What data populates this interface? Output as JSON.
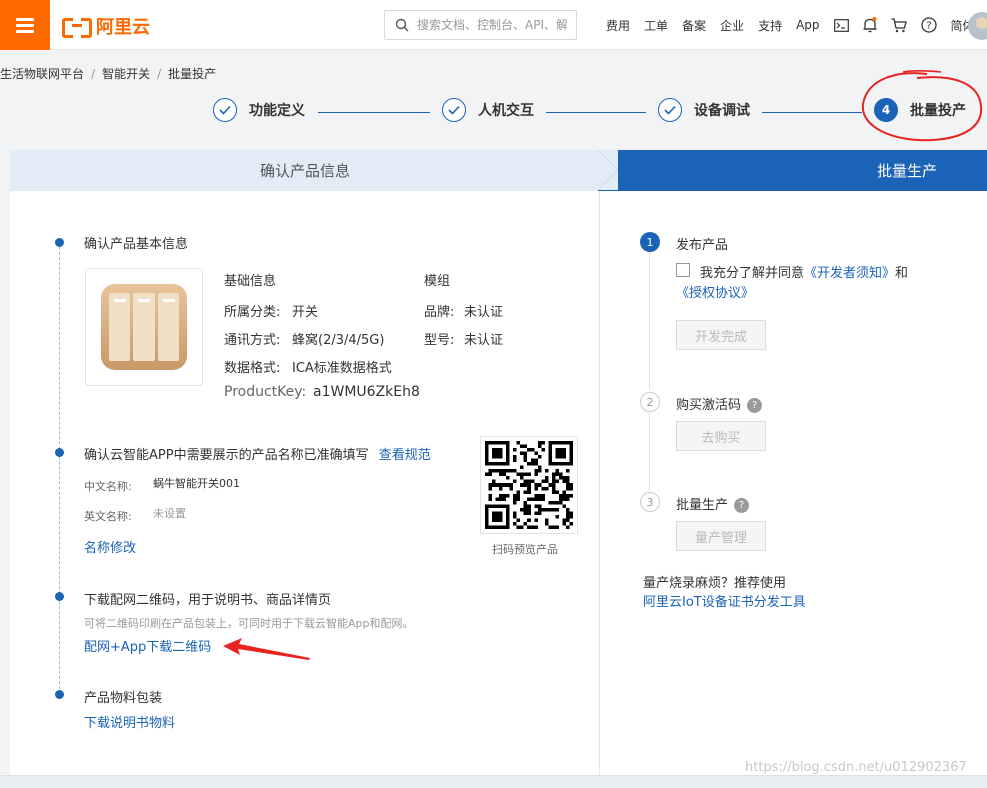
{
  "header": {
    "logo_text": "阿里云",
    "search_placeholder": "搜索文档、控制台、API、解",
    "nav": [
      "费用",
      "工单",
      "备案",
      "企业",
      "支持",
      "App"
    ],
    "lang": "简体",
    "icons": [
      "terminal-icon",
      "bell-icon",
      "cart-icon",
      "help-icon"
    ],
    "accent": "#ff6a00"
  },
  "breadcrumb": [
    "生活物联网平台",
    "智能开关",
    "批量投产"
  ],
  "steps": [
    {
      "label": "功能定义",
      "state": "done"
    },
    {
      "label": "人机交互",
      "state": "done"
    },
    {
      "label": "设备调试",
      "state": "done"
    },
    {
      "label": "批量投产",
      "state": "active",
      "number": "4"
    }
  ],
  "panels": {
    "left_title": "确认产品信息",
    "right_title": "批量生产"
  },
  "basic": {
    "title": "确认产品基本信息",
    "col1_head": "基础信息",
    "col2_head": "模组",
    "category_label": "所属分类:",
    "category_value": "开关",
    "comm_label": "通讯方式:",
    "comm_value": "蜂窝(2/3/4/5G)",
    "format_label": "数据格式:",
    "format_value": "ICA标准数据格式",
    "brand_label": "品牌:",
    "brand_value": "未认证",
    "model_label": "型号:",
    "model_value": "未认证",
    "productkey_label": "ProductKey:",
    "productkey_value": "a1WMU6ZkEh8"
  },
  "naming": {
    "title": "确认云智能APP中需要展示的产品名称已准确填写",
    "spec_link": "查看规范",
    "cn_label": "中文名称:",
    "cn_value": "蜗牛智能开关001",
    "en_label": "英文名称:",
    "en_value": "未设置",
    "edit_link": "名称修改",
    "qr_caption": "扫码预览产品"
  },
  "qrcode": {
    "title": "下载配网二维码，用于说明书、商品详情页",
    "desc": "可将二维码印刷在产品包装上，可同时用于下载云智能App和配网。",
    "link": "配网+App下载二维码"
  },
  "packaging": {
    "title": "产品物料包装",
    "link": "下载说明书物料"
  },
  "right": {
    "s1_num": "1",
    "s1_title": "发布产品",
    "agree_prefix": "我充分了解并同意",
    "agree_link1": "《开发者须知》",
    "agree_and": "和",
    "agree_link2": "《授权协议》",
    "s1_button": "开发完成",
    "s2_num": "2",
    "s2_title": "购买激活码",
    "s2_button": "去购买",
    "s3_num": "3",
    "s3_title": "批量生产",
    "s3_button": "量产管理",
    "tip": "量产烧录麻烦？推荐使用",
    "tip_link": "阿里云IoT设备证书分发工具"
  },
  "watermark": "https://blog.csdn.net/u012902367",
  "colors": {
    "primary": "#1b63b7",
    "annotation": "#e8231f",
    "header_bg": "#e1ecf7"
  }
}
